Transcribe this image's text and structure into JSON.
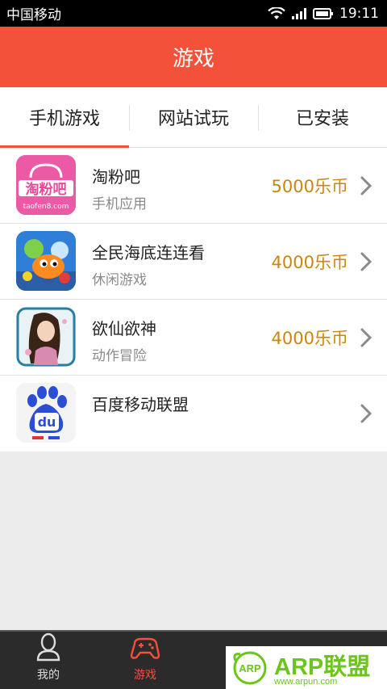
{
  "status_bar": {
    "carrier": "中国移动",
    "time": "19:11"
  },
  "header": {
    "title": "游戏"
  },
  "tabs": [
    {
      "label": "手机游戏",
      "active": true
    },
    {
      "label": "网站试玩",
      "active": false
    },
    {
      "label": "已安装",
      "active": false
    }
  ],
  "apps": [
    {
      "name": "淘粉吧",
      "category": "手机应用",
      "price": "5000乐币",
      "icon": "taofen8-icon",
      "icon_text": "淘粉吧",
      "icon_sub": "taofen8.com"
    },
    {
      "name": "全民海底连连看",
      "category": "休闲游戏",
      "price": "4000乐币",
      "icon": "fish-game-icon"
    },
    {
      "name": "欲仙欲神",
      "category": "动作冒险",
      "price": "4000乐币",
      "icon": "fairy-game-icon"
    },
    {
      "name": "百度移动联盟",
      "category": "",
      "price": "",
      "icon": "baidu-paw-icon",
      "icon_text": "du"
    }
  ],
  "bottom_nav": [
    {
      "label": "我的",
      "icon": "person-icon",
      "active": false
    },
    {
      "label": "游戏",
      "icon": "gamepad-icon",
      "active": true
    },
    {
      "label": "",
      "icon": "tv-icon",
      "active": false
    },
    {
      "label": "",
      "icon": "settings-icon",
      "active": false
    }
  ],
  "watermark": {
    "logo_text": "ARP",
    "text": "ARP联盟",
    "url": "www.arpun.com"
  },
  "colors": {
    "accent": "#f4513b",
    "price": "#c8860e",
    "watermark": "#6cc51b"
  }
}
